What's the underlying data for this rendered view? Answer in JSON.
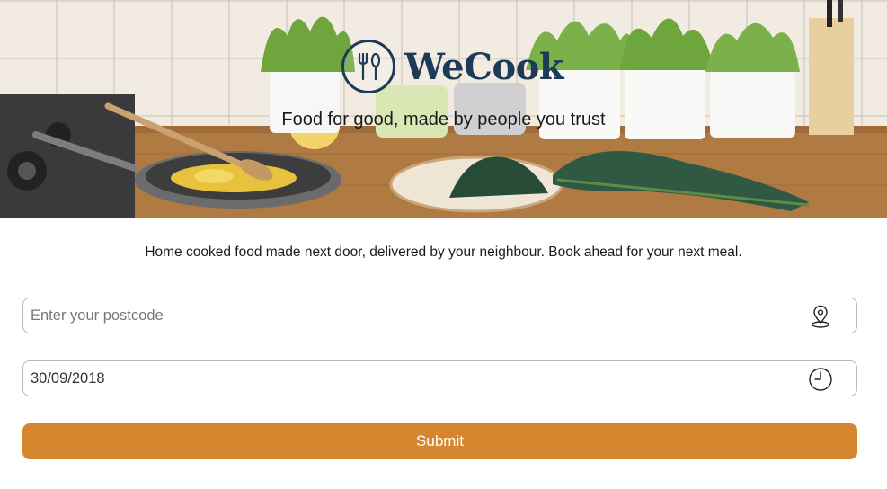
{
  "brand": {
    "name": "WeCook",
    "tagline": "Food for good, made by people you trust",
    "colors": {
      "primary": "#1d3a57",
      "accent": "#d6862e"
    }
  },
  "intro": {
    "text": "Home cooked food made next door, delivered by your neighbour. Book ahead for your next meal."
  },
  "form": {
    "postcode": {
      "placeholder": "Enter your postcode",
      "value": "",
      "icon": "location-pin-icon"
    },
    "date": {
      "value": "30/09/2018",
      "icon": "clock-icon"
    },
    "submit_label": "Submit"
  }
}
